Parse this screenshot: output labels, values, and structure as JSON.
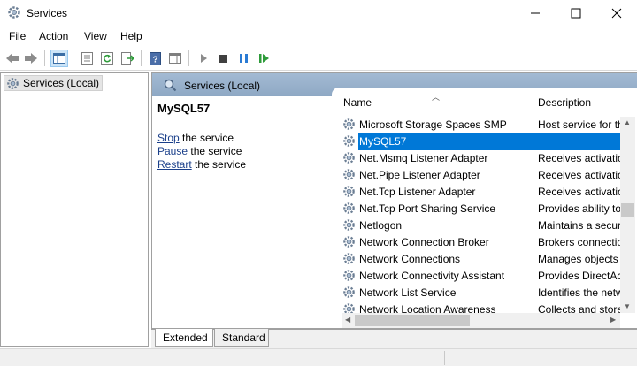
{
  "window": {
    "title": "Services",
    "icon": "gear-icon"
  },
  "menu": [
    "File",
    "Action",
    "View",
    "Help"
  ],
  "tree": {
    "root_label": "Services (Local)"
  },
  "main": {
    "header_label": "Services (Local)",
    "selected_service": "MySQL57",
    "actions": [
      {
        "link": "Stop",
        "rest": " the service"
      },
      {
        "link": "Pause",
        "rest": " the service"
      },
      {
        "link": "Restart",
        "rest": " the service"
      }
    ]
  },
  "columns": {
    "name": "Name",
    "description": "Description"
  },
  "services": [
    {
      "name": "Microsoft Storage Spaces SMP",
      "description": "Host service for the",
      "selected": false
    },
    {
      "name": "MySQL57",
      "description": "",
      "selected": true
    },
    {
      "name": "Net.Msmq Listener Adapter",
      "description": "Receives activation",
      "selected": false
    },
    {
      "name": "Net.Pipe Listener Adapter",
      "description": "Receives activation",
      "selected": false
    },
    {
      "name": "Net.Tcp Listener Adapter",
      "description": "Receives activation",
      "selected": false
    },
    {
      "name": "Net.Tcp Port Sharing Service",
      "description": "Provides ability to",
      "selected": false
    },
    {
      "name": "Netlogon",
      "description": "Maintains a secure",
      "selected": false
    },
    {
      "name": "Network Connection Broker",
      "description": "Brokers connection",
      "selected": false
    },
    {
      "name": "Network Connections",
      "description": "Manages objects",
      "selected": false
    },
    {
      "name": "Network Connectivity Assistant",
      "description": "Provides DirectAcc",
      "selected": false
    },
    {
      "name": "Network List Service",
      "description": "Identifies the netw",
      "selected": false
    },
    {
      "name": "Network Location Awareness",
      "description": "Collects and stores",
      "selected": false
    }
  ],
  "tabs": [
    {
      "label": "Extended",
      "active": true
    },
    {
      "label": "Standard",
      "active": false
    }
  ],
  "colors": {
    "selection": "#0078d7",
    "header_band": "#a3bad3",
    "link": "#1a3f8a"
  }
}
